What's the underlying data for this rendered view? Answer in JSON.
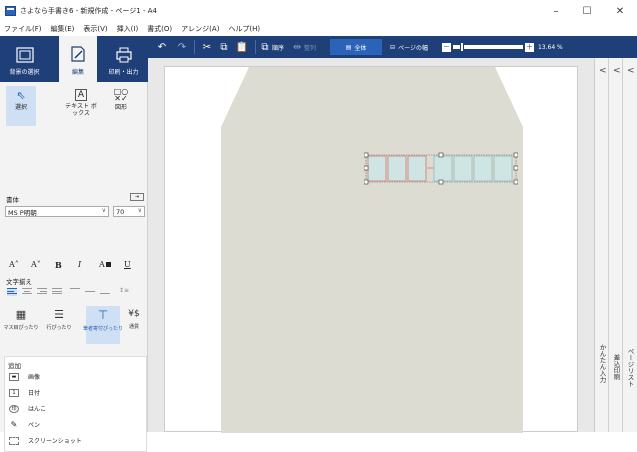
{
  "window": {
    "title": "さよなら手書き6 - 新規作成 - ページ1 - A4",
    "minimize": "–",
    "maximize": "☐",
    "close": "✕"
  },
  "menu": [
    "ファイル(F)",
    "編集(E)",
    "表示(V)",
    "挿入(I)",
    "書式(O)",
    "アレンジ(A)",
    "ヘルプ(H)"
  ],
  "toolbar": {
    "group_label": "順序",
    "arrange_label": "整列",
    "whole_label": "全体",
    "page_width_label": "ページの幅",
    "zoom_minus": "－",
    "zoom_plus": "＋",
    "zoom_value": "13.64 %",
    "zoom_level": 0.1
  },
  "modes": {
    "background": "背景の選択",
    "edit": "編集",
    "print": "印刷・出力"
  },
  "tools": {
    "select": "選択",
    "textbox": "テキスト ボックス",
    "shape": "図形"
  },
  "font": {
    "section_label": "書体",
    "family": "MS P明朝",
    "size": "70",
    "larger": "A˄",
    "smaller": "A˅",
    "bold": "B",
    "italic": "I",
    "color": "A",
    "underline": "U"
  },
  "align": {
    "section_label": "文字揃え",
    "justify_fit": "↕≡"
  },
  "layout_buttons": {
    "b1": "マス目ぴったり",
    "b2": "行ぴったり",
    "b3": "筆者寄付ぴったり",
    "b4": "通貨",
    "b4_icon": "¥$"
  },
  "add": {
    "section_label": "追加",
    "items": [
      "画像",
      "日付",
      "はんこ",
      "ペン",
      "スクリーンショット"
    ]
  },
  "right_rail": {
    "tab1": "かんたん入力",
    "tab2": "差込印刷",
    "tab3": "ページリスト",
    "chevron": "<"
  },
  "colors": {
    "toolbar_bg": "#1e3f78",
    "accent": "#2a63b8",
    "envelope": "#dcdcd2",
    "cell_fill": "#cfe5e3",
    "cell_border": "#d07a7a"
  }
}
